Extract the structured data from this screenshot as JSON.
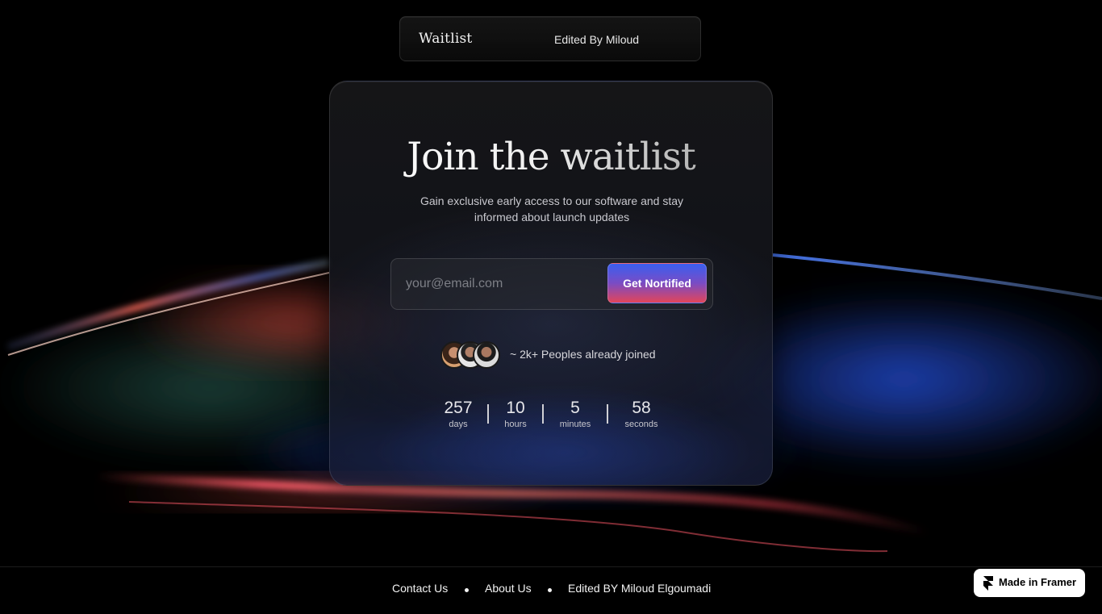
{
  "nav": {
    "brand": "Waitlist",
    "edited_by": "Edited By Miloud"
  },
  "hero": {
    "title": "Join the waitlist",
    "subtitle": "Gain exclusive early access to our software and stay informed about launch updates"
  },
  "signup": {
    "email_placeholder": "your@email.com",
    "email_value": "",
    "button_label": "Get Nortified"
  },
  "social_proof": {
    "text": "~ 2k+ Peoples already joined"
  },
  "countdown": [
    {
      "value": "257",
      "label": "days"
    },
    {
      "value": "10",
      "label": "hours"
    },
    {
      "value": "5",
      "label": "minutes"
    },
    {
      "value": "58",
      "label": "seconds"
    }
  ],
  "footer": {
    "links": [
      "Contact Us",
      "About Us",
      "Edited BY Miloud Elgoumadi"
    ]
  },
  "badge": {
    "label": "Made in Framer",
    "icon": "framer-logo-icon"
  },
  "colors": {
    "background": "#000000",
    "button_gradient_top": "#3a5ff0",
    "button_gradient_bottom": "#e2455a",
    "wave_red": "#ff4a4a",
    "wave_blue": "#3a6cff"
  }
}
